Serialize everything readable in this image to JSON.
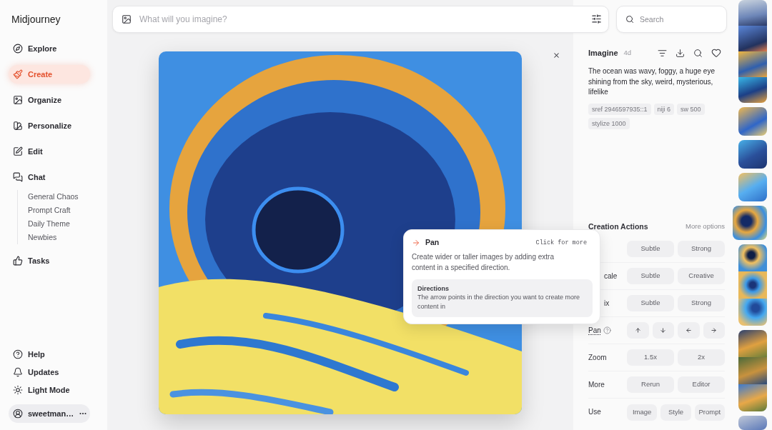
{
  "sidebar": {
    "logo": "Midjourney",
    "nav": [
      {
        "label": "Explore",
        "selected": false
      },
      {
        "label": "Create",
        "selected": true
      },
      {
        "label": "Organize",
        "selected": false
      },
      {
        "label": "Personalize",
        "selected": false
      },
      {
        "label": "Edit",
        "selected": false
      },
      {
        "label": "Chat",
        "selected": false,
        "children": [
          {
            "label": "General Chaos",
            "selected": false
          },
          {
            "label": "Prompt Craft",
            "selected": false
          },
          {
            "label": "Daily Theme",
            "selected": false
          },
          {
            "label": "Newbies",
            "selected": false
          }
        ]
      },
      {
        "label": "Tasks",
        "selected": false
      }
    ],
    "footer": [
      {
        "label": "Help"
      },
      {
        "label": "Updates"
      },
      {
        "label": "Light Mode"
      }
    ],
    "user": {
      "name": "sweetman…"
    }
  },
  "prompt_bar": {
    "placeholder": "What will you imagine?"
  },
  "search": {
    "placeholder": "Search"
  },
  "details": {
    "title": "Imagine",
    "age": "4d",
    "prompt": "The ocean was wavy, foggy, a huge eye shining from the sky, weird, mysterious, lifelike",
    "tags": [
      "sref 2946597935::1",
      "niji 6",
      "sw 500",
      "stylize 1000"
    ]
  },
  "creation_actions": {
    "title": "Creation Actions",
    "more": "More options",
    "rows": [
      {
        "kind": "covered",
        "buttons": [
          "Subtle",
          "Strong"
        ]
      },
      {
        "kind": "covered",
        "label": "cale",
        "buttons": [
          "Subtle",
          "Creative"
        ]
      },
      {
        "kind": "covered",
        "label": "ix",
        "buttons": [
          "Subtle",
          "Strong"
        ]
      },
      {
        "kind": "pan",
        "label": "Pan"
      },
      {
        "kind": "plain",
        "label": "Zoom",
        "buttons": [
          "1.5x",
          "2x"
        ]
      },
      {
        "kind": "plain",
        "label": "More",
        "buttons": [
          "Rerun",
          "Editor"
        ]
      },
      {
        "kind": "plain",
        "label": "Use",
        "buttons": [
          "Image",
          "Style",
          "Prompt"
        ]
      }
    ]
  },
  "tooltip": {
    "title": "Pan",
    "hint": "Click for more",
    "text": "Create wider or taller images by adding extra content in a specified direction.",
    "note": {
      "title": "Directions",
      "text": "The arrow points in the direction you want to create more content in"
    }
  },
  "thumbnail_strip": [
    {
      "thumbnails": [
        {
          "selected": false
        },
        {
          "selected": false
        },
        {
          "selected": false
        },
        {
          "selected": false
        }
      ]
    },
    {
      "thumbnails": [
        {
          "selected": false
        }
      ]
    },
    {
      "thumbnails": [
        {
          "selected": false
        }
      ]
    },
    {
      "thumbnails": [
        {
          "selected": false
        }
      ]
    },
    {
      "thumbnails": [
        {
          "selected": true
        }
      ]
    },
    {
      "thumbnails": [
        {
          "selected": false
        },
        {
          "selected": false
        },
        {
          "selected": false
        }
      ]
    },
    {
      "thumbnails": [
        {
          "selected": false
        },
        {
          "selected": false
        },
        {
          "selected": false
        }
      ]
    },
    {
      "thumbnails": [
        {
          "selected": false
        }
      ]
    }
  ]
}
